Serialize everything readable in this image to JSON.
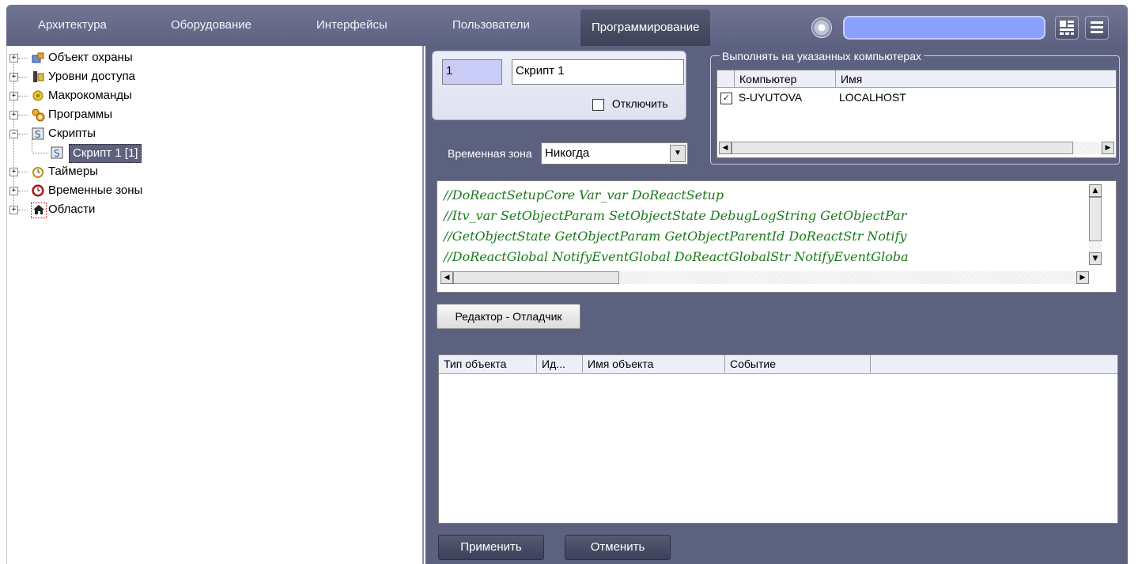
{
  "tabs": [
    {
      "label": "Архитектура",
      "active": false
    },
    {
      "label": "Оборудование",
      "active": false
    },
    {
      "label": "Интерфейсы",
      "active": false
    },
    {
      "label": "Пользователи",
      "active": false
    },
    {
      "label": "Программирование",
      "active": true
    }
  ],
  "search": {
    "value": ""
  },
  "tree": {
    "items": [
      {
        "label": "Объект охраны",
        "icon": "guard-object-icon",
        "expander": "+"
      },
      {
        "label": "Уровни доступа",
        "icon": "access-levels-icon",
        "expander": "+"
      },
      {
        "label": "Макрокоманды",
        "icon": "macros-icon",
        "expander": "+"
      },
      {
        "label": "Программы",
        "icon": "programs-icon",
        "expander": "+"
      },
      {
        "label": "Скрипты",
        "icon": "scripts-icon",
        "expander": "−"
      },
      {
        "label": "Скрипт 1 [1]",
        "icon": "script-icon",
        "selected": true
      },
      {
        "label": "Таймеры",
        "icon": "timers-icon",
        "expander": "+"
      },
      {
        "label": "Временные зоны",
        "icon": "time-zones-icon",
        "expander": "+"
      },
      {
        "label": "Области",
        "icon": "areas-icon",
        "expander": "+"
      }
    ]
  },
  "script": {
    "id": "1",
    "name": "Скрипт 1",
    "disable_label": "Отключить",
    "disabled": false,
    "time_zone_label": "Временная зона",
    "time_zone_value": "Никогда"
  },
  "computers": {
    "group_label": "Выполнять на указанных компьютерах",
    "columns": [
      "Компьютер",
      "Имя"
    ],
    "rows": [
      {
        "computer": "S-UYUTOVA",
        "name": "LOCALHOST",
        "checked": true
      }
    ]
  },
  "code": {
    "lines": [
      "//DoReactSetupCore Var_var DoReactSetup",
      "//Itv_var SetObjectParam SetObjectState DebugLogString GetObjectPar",
      "//GetObjectState GetObjectParam GetObjectParentId DoReactStr Notify",
      "//DoReactGlobal NotifyEventGlobal DoReactGlobalStr NotifyEventGloba"
    ]
  },
  "editor_button": "Редактор - Отладчик",
  "events_table": {
    "columns": [
      "Тип объекта",
      "Ид...",
      "Имя объекта",
      "Событие"
    ]
  },
  "footer": {
    "apply": "Применить",
    "cancel": "Отменить"
  }
}
